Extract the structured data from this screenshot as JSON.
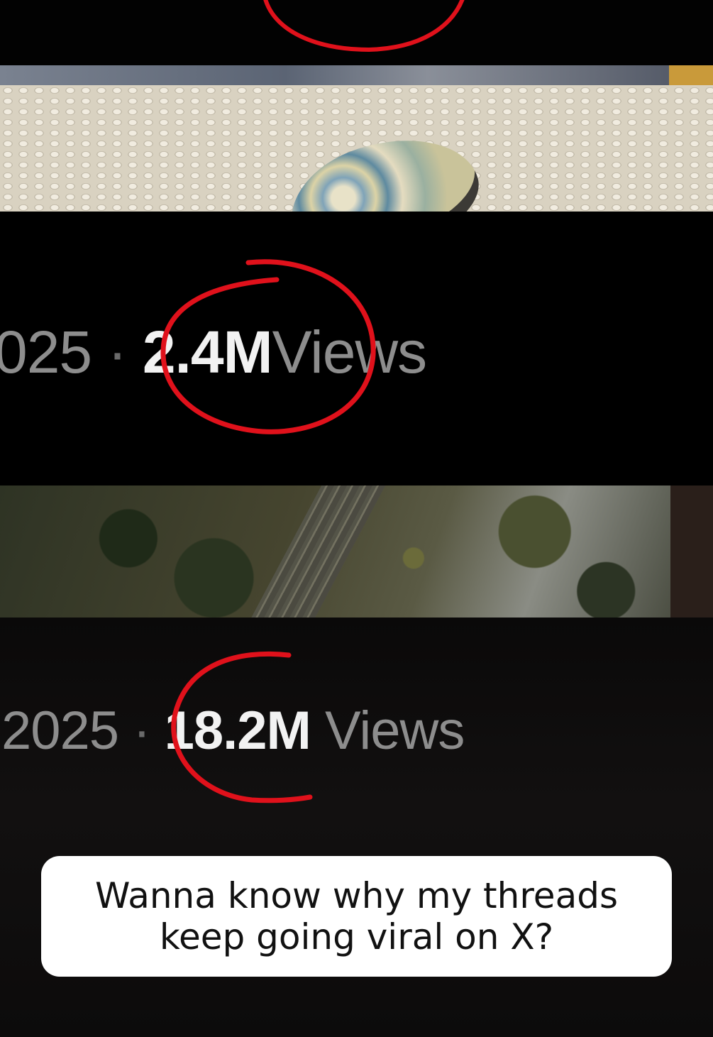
{
  "metrics": [
    {
      "year": "025",
      "separator": "·",
      "views_count": "2.4M",
      "views_label": "Views"
    },
    {
      "year": "2025",
      "separator": "·",
      "views_count": "18.2M",
      "views_label": "Views"
    }
  ],
  "caption": {
    "line1": "Wanna know why my threads",
    "line2": "keep going viral on X?"
  },
  "colors": {
    "highlight_circle": "#e0111b",
    "caption_background": "#ffffff"
  }
}
